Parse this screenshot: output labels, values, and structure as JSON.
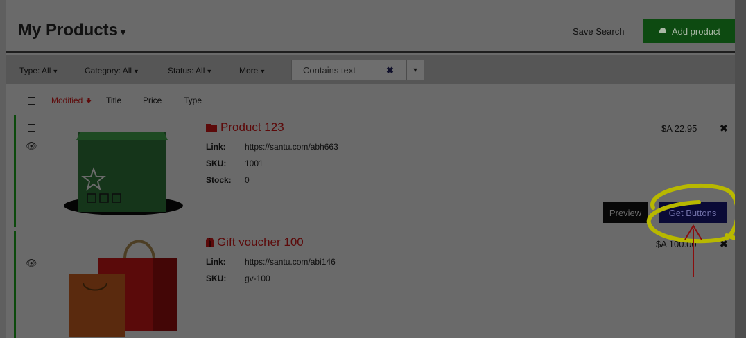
{
  "header": {
    "title": "My Products",
    "title_caret": "▾",
    "save_search": "Save Search",
    "add_product": "Add product",
    "add_icon": "car-icon"
  },
  "filters": {
    "type": "Type: All",
    "category": "Category: All",
    "status": "Status: All",
    "more": "More",
    "search_placeholder": "Contains text",
    "clear_icon": "✖",
    "dropdown_icon": "▼"
  },
  "columns": {
    "modified": "Modified",
    "modified_icon": "arrow-down-icon",
    "title": "Title",
    "price": "Price",
    "type": "Type"
  },
  "products": [
    {
      "name": "Product 123",
      "icon": "package-icon",
      "link_label": "Link:",
      "link": "https://santu.com/abh663",
      "sku_label": "SKU:",
      "sku": "1001",
      "stock_label": "Stock:",
      "stock": "0",
      "price": "$A 22.95",
      "image": "green-box-image"
    },
    {
      "name": "Gift voucher 100",
      "icon": "gift-icon",
      "link_label": "Link:",
      "link": "https://santu.com/abi146",
      "sku_label": "SKU:",
      "sku": "gv-100",
      "price": "$A 100.00",
      "image": "shopping-bags-image"
    }
  ],
  "actions": {
    "preview": "Preview",
    "get_buttons": "Get Buttons"
  },
  "colors": {
    "brand_green": "#0d4a11",
    "title_red": "#5c0a0a",
    "get_buttons_blue": "#0a0a36",
    "highlight_yellow": "#b8b800",
    "arrow_red": "#8a0e0e"
  }
}
